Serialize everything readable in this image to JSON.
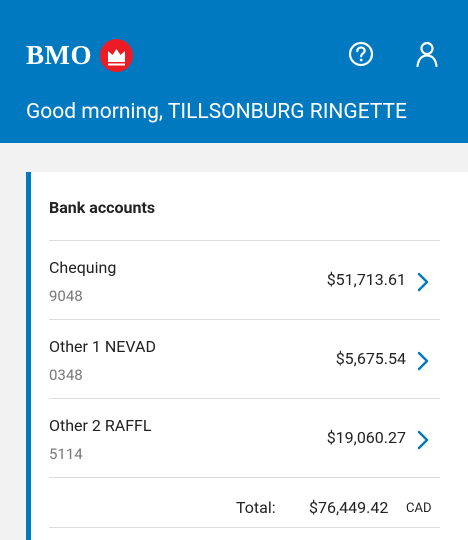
{
  "header": {
    "logo_text": "BMO",
    "greeting": "Good morning, TILLSONBURG RINGETTE",
    "help_icon": "help-circle-icon",
    "profile_icon": "user-icon"
  },
  "colors": {
    "brand_blue": "#0079c1",
    "brand_red": "#ed1c24",
    "background": "#f2f2f2"
  },
  "bank_accounts": {
    "title": "Bank accounts",
    "accounts": [
      {
        "name": "Chequing",
        "number": "9048",
        "balance": "$51,713.61"
      },
      {
        "name": "Other 1 NEVAD",
        "number": "0348",
        "balance": "$5,675.54"
      },
      {
        "name": "Other 2 RAFFL",
        "number": "5114",
        "balance": "$19,060.27"
      }
    ],
    "total_label": "Total:",
    "total_value": "$76,449.42",
    "total_currency": "CAD"
  }
}
